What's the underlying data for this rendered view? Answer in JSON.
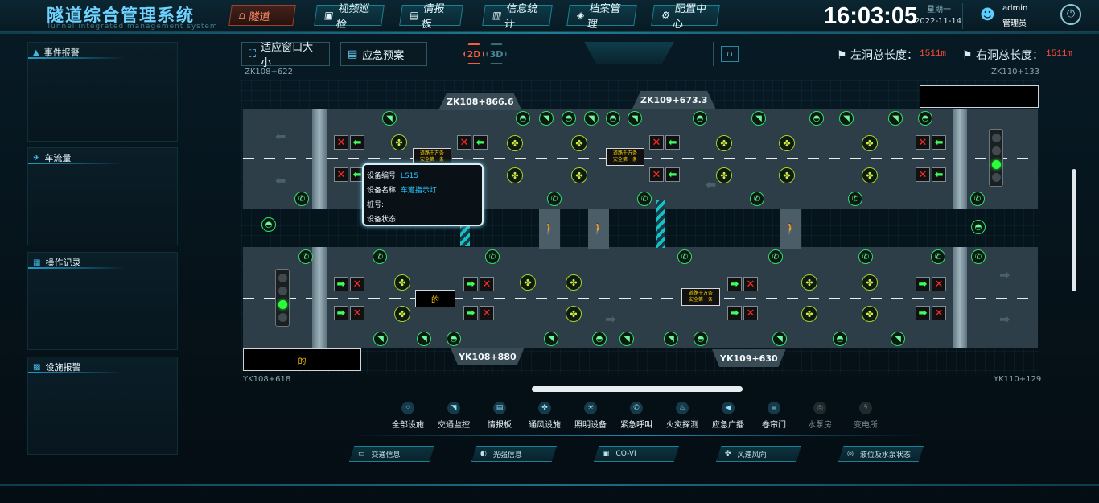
{
  "header": {
    "title": "隧道综合管理系统",
    "subtitle": "Tunnel integrated management system",
    "nav": [
      {
        "label": "隧道",
        "icon": "tunnel-icon",
        "active": true
      },
      {
        "label": "视频巡检",
        "icon": "video-icon"
      },
      {
        "label": "情报板",
        "icon": "board-icon"
      },
      {
        "label": "信息统计",
        "icon": "stats-icon"
      },
      {
        "label": "档案管理",
        "icon": "archive-icon"
      },
      {
        "label": "配置中心",
        "icon": "gear-icon"
      }
    ],
    "time": "16:03:05",
    "weekday": "星期一",
    "date": "2022-11-14",
    "user": {
      "name": "admin",
      "role": "管理员"
    }
  },
  "panels": {
    "events": "事件报警",
    "traffic": "车流量",
    "operations": "操作记录",
    "device_alarm": "设施报警"
  },
  "toolbar": {
    "fit_window": "适应窗口大小",
    "emergency_plan": "应急预案",
    "mode_2d": "2D",
    "mode_3d": "3D",
    "left_total_label": "左洞总长度：",
    "left_total": "1511m",
    "right_total_label": "右洞总长度：",
    "right_total": "1511m"
  },
  "map": {
    "stake_top_left": "ZK108+622",
    "stake_top_right": "ZK110+133",
    "stake_bottom_left": "YK108+618",
    "stake_bottom_right": "YK110+129",
    "tag_top_1": "ZK108+866.6",
    "tag_top_2": "ZK109+673.3",
    "tag_bottom_1": "YK108+880",
    "tag_bottom_2": "YK109+630",
    "board_text_1": "道路千万条",
    "board_text_2": "安全第一条",
    "sign_char": "的",
    "tooltip": {
      "id_label": "设备编号:",
      "id_value": "LS15",
      "name_label": "设备名称:",
      "name_value": "车道指示灯",
      "stake_label": "桩号:",
      "status_label": "设备状态:"
    }
  },
  "categories": [
    {
      "label": "全部设施",
      "icon": "all-icon"
    },
    {
      "label": "交通监控",
      "icon": "camera-icon"
    },
    {
      "label": "情报板",
      "icon": "board-icon"
    },
    {
      "label": "通风设施",
      "icon": "fan-icon"
    },
    {
      "label": "照明设备",
      "icon": "light-icon"
    },
    {
      "label": "紧急呼叫",
      "icon": "phone-icon"
    },
    {
      "label": "火灾探测",
      "icon": "fire-icon"
    },
    {
      "label": "应急广播",
      "icon": "speaker-icon"
    },
    {
      "label": "卷帘门",
      "icon": "door-icon"
    },
    {
      "label": "水泵房",
      "icon": "pump-icon",
      "dim": true
    },
    {
      "label": "变电所",
      "icon": "power-icon",
      "dim": true
    }
  ],
  "status_buttons": [
    {
      "label": "交通信息",
      "icon": "car-icon"
    },
    {
      "label": "光强信息",
      "icon": "sun-icon"
    },
    {
      "label": "CO-VI",
      "icon": "co-icon"
    },
    {
      "label": "风速风向",
      "icon": "wind-icon"
    },
    {
      "label": "液位及水泵状态",
      "icon": "pump-icon"
    }
  ]
}
